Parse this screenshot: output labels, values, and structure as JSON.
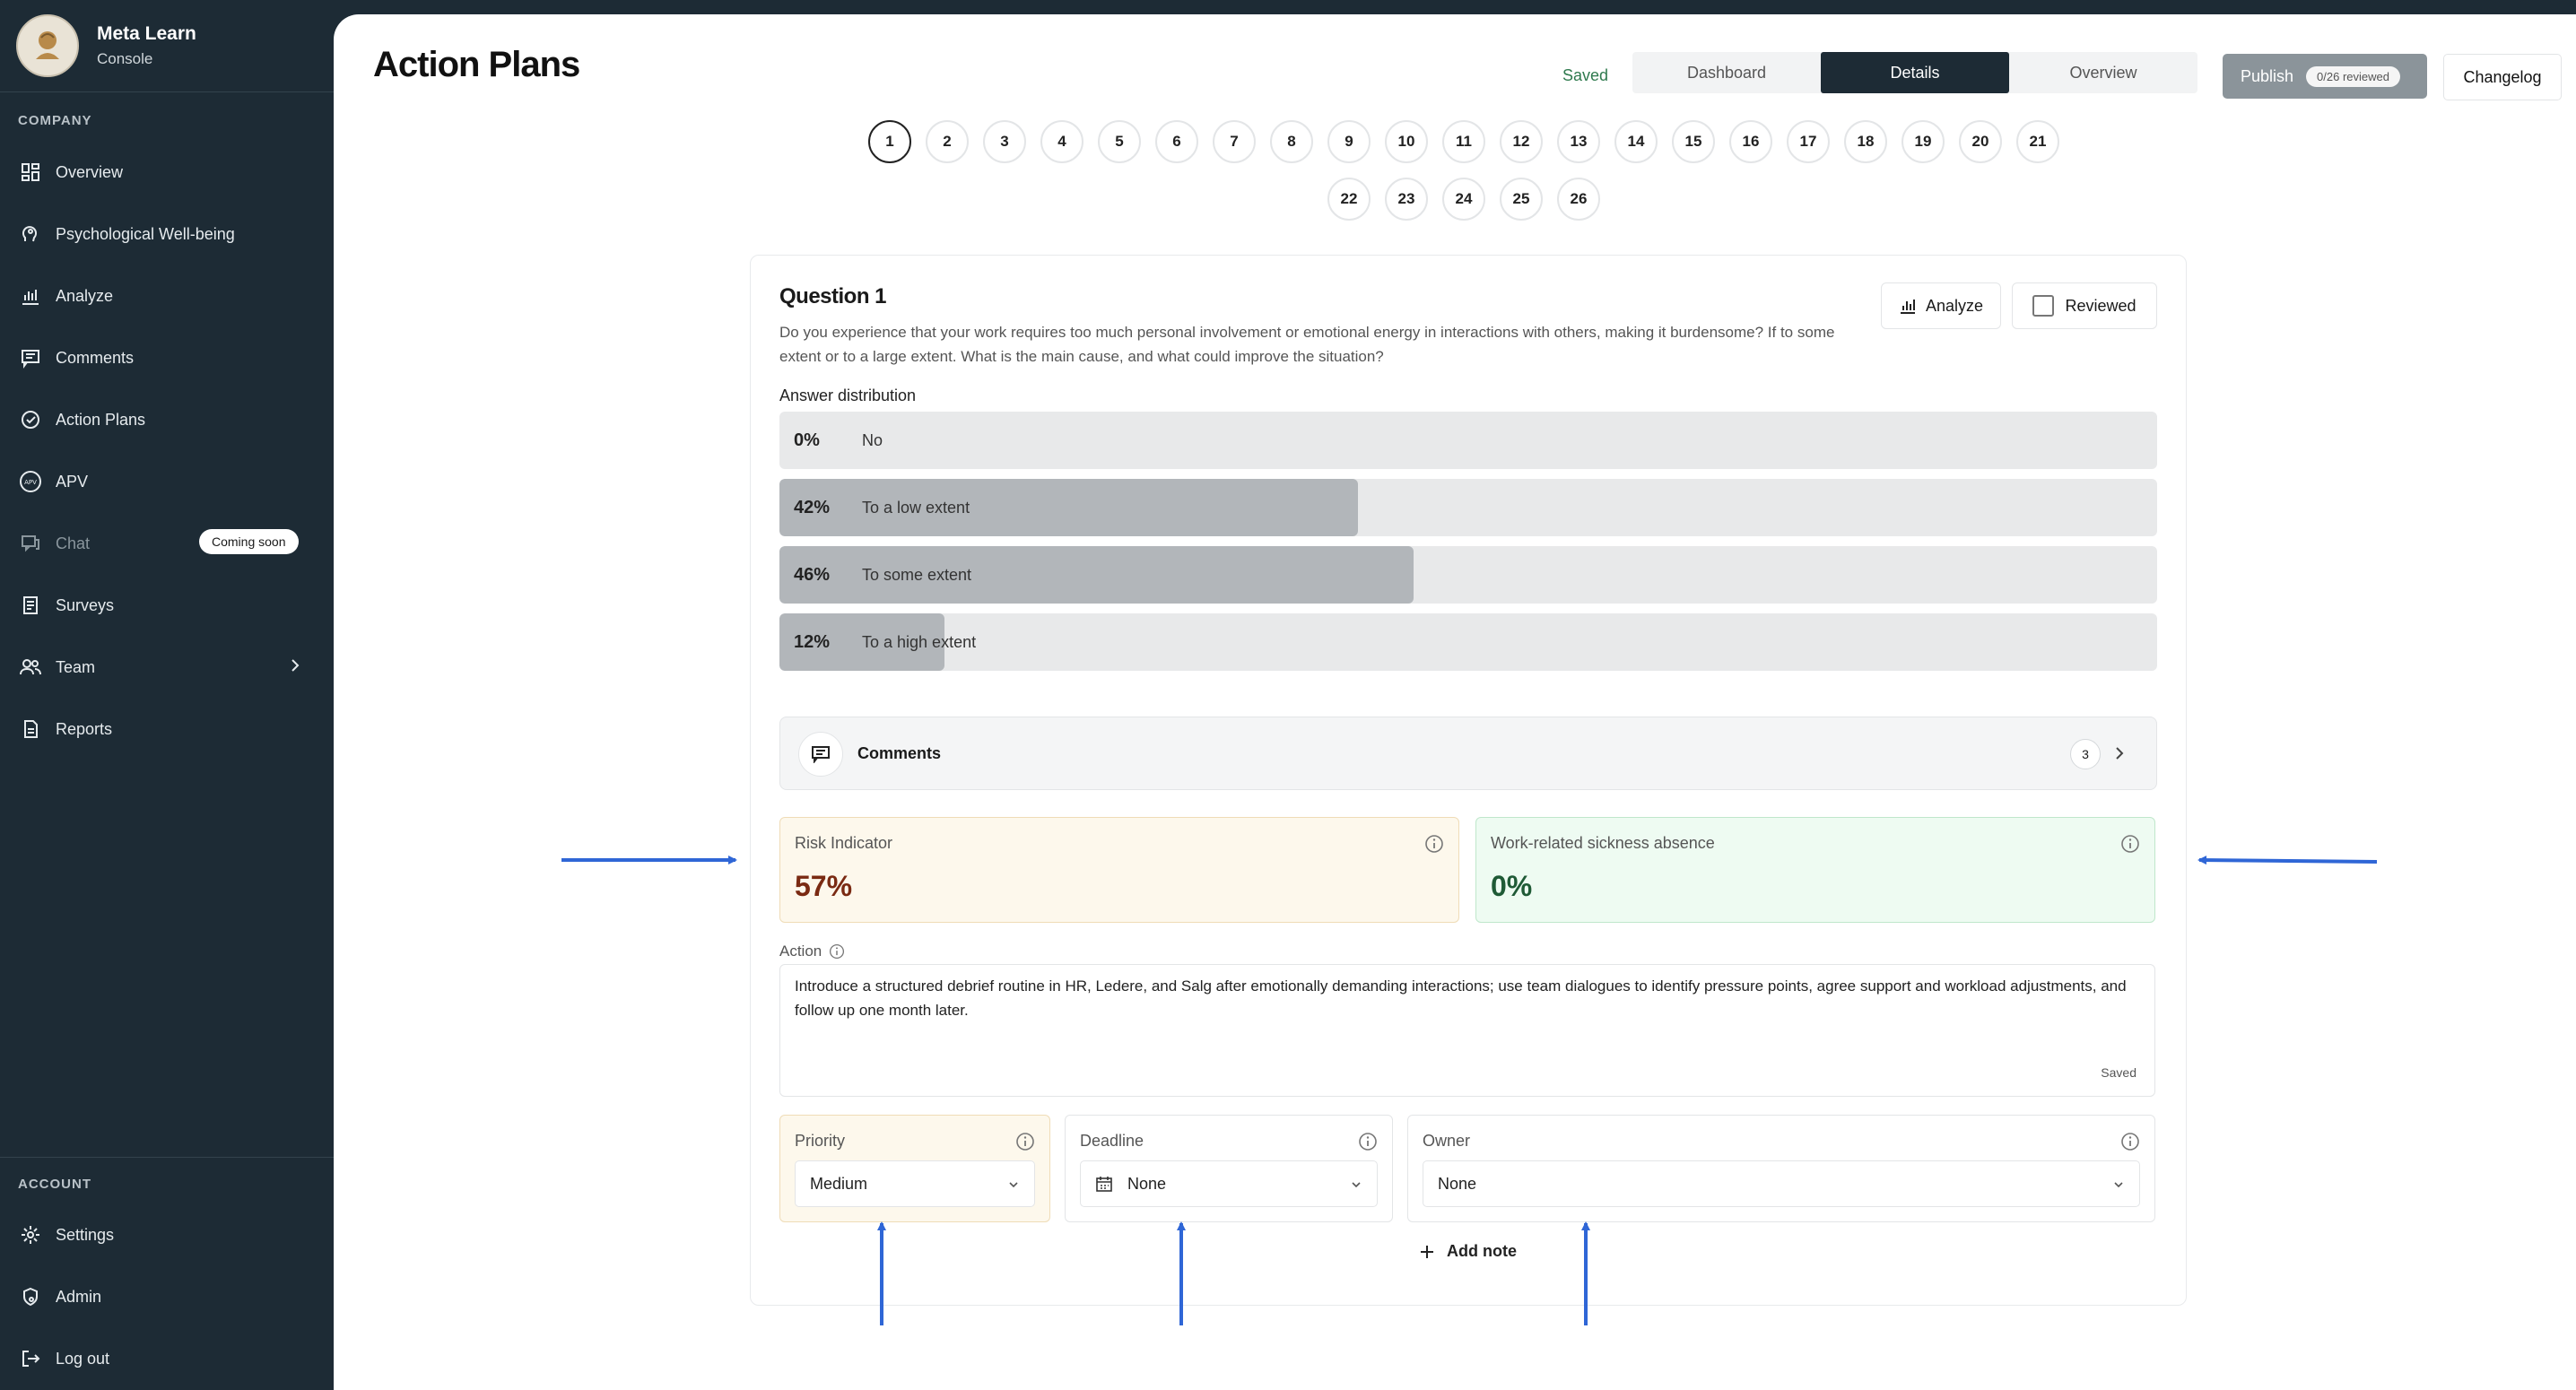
{
  "sidebar": {
    "brand": {
      "name": "Meta Learn",
      "sub": "Console"
    },
    "section_company": "COMPANY",
    "section_account": "ACCOUNT",
    "items": [
      {
        "label": "Overview",
        "icon": "dashboard-icon"
      },
      {
        "label": "Psychological Well-being",
        "icon": "head-icon"
      },
      {
        "label": "Analyze",
        "icon": "bar-chart-icon"
      },
      {
        "label": "Comments",
        "icon": "comment-icon"
      },
      {
        "label": "Action Plans",
        "icon": "check-circle-icon"
      },
      {
        "label": "APV",
        "icon": "apv-icon"
      },
      {
        "label": "Chat",
        "icon": "chat-icon",
        "badge": "Coming soon"
      },
      {
        "label": "Surveys",
        "icon": "survey-icon"
      },
      {
        "label": "Team",
        "icon": "team-icon"
      },
      {
        "label": "Reports",
        "icon": "report-icon"
      }
    ],
    "account_items": [
      {
        "label": "Settings",
        "icon": "gear-icon"
      },
      {
        "label": "Admin",
        "icon": "admin-icon"
      },
      {
        "label": "Log out",
        "icon": "logout-icon"
      }
    ]
  },
  "header": {
    "title": "Action Plans",
    "saved": "Saved",
    "tabs": [
      "Dashboard",
      "Details",
      "Overview"
    ],
    "active_tab": "Details",
    "publish": "Publish",
    "reviewed_count": "0/26 reviewed",
    "changelog": "Changelog"
  },
  "question_numbers": [
    "1",
    "2",
    "3",
    "4",
    "5",
    "6",
    "7",
    "8",
    "9",
    "10",
    "11",
    "12",
    "13",
    "14",
    "15",
    "16",
    "17",
    "18",
    "19",
    "20",
    "21",
    "22",
    "23",
    "24",
    "25",
    "26"
  ],
  "active_question": "1",
  "question": {
    "title": "Question 1",
    "text": "Do you experience that your work requires too much personal involvement or emotional energy in interactions with others, making it burdensome? If to some extent or to a large extent. What is the main cause, and what could improve the situation?",
    "analyze": "Analyze",
    "reviewed": "Reviewed",
    "answer_label": "Answer distribution",
    "answers": [
      {
        "pct": "0%",
        "label": "No",
        "fraction": 0.0
      },
      {
        "pct": "42%",
        "label": "To a low extent",
        "fraction": 0.42
      },
      {
        "pct": "46%",
        "label": "To some extent",
        "fraction": 0.46
      },
      {
        "pct": "12%",
        "label": "To a high extent",
        "fraction": 0.12
      }
    ],
    "comments_label": "Comments",
    "comments_count": "3"
  },
  "metrics": {
    "risk": {
      "label": "Risk Indicator",
      "value": "57%",
      "color": "#7a2a12"
    },
    "sick": {
      "label": "Work-related sickness absence",
      "value": "0%",
      "color": "#1f5a36"
    }
  },
  "action": {
    "label": "Action",
    "text": "Introduce a structured debrief routine in HR, Ledere, and Salg after emotionally demanding interactions; use team dialogues to identify pressure points, agree support and workload adjustments, and follow up one month later.",
    "saved": "Saved"
  },
  "fields": {
    "priority": {
      "label": "Priority",
      "value": "Medium"
    },
    "deadline": {
      "label": "Deadline",
      "value": "None"
    },
    "owner": {
      "label": "Owner",
      "value": "None"
    }
  },
  "add_note": "Add note",
  "colors": {
    "sidebar": "#1d2b35",
    "accent_arrow": "#2f66d6"
  }
}
